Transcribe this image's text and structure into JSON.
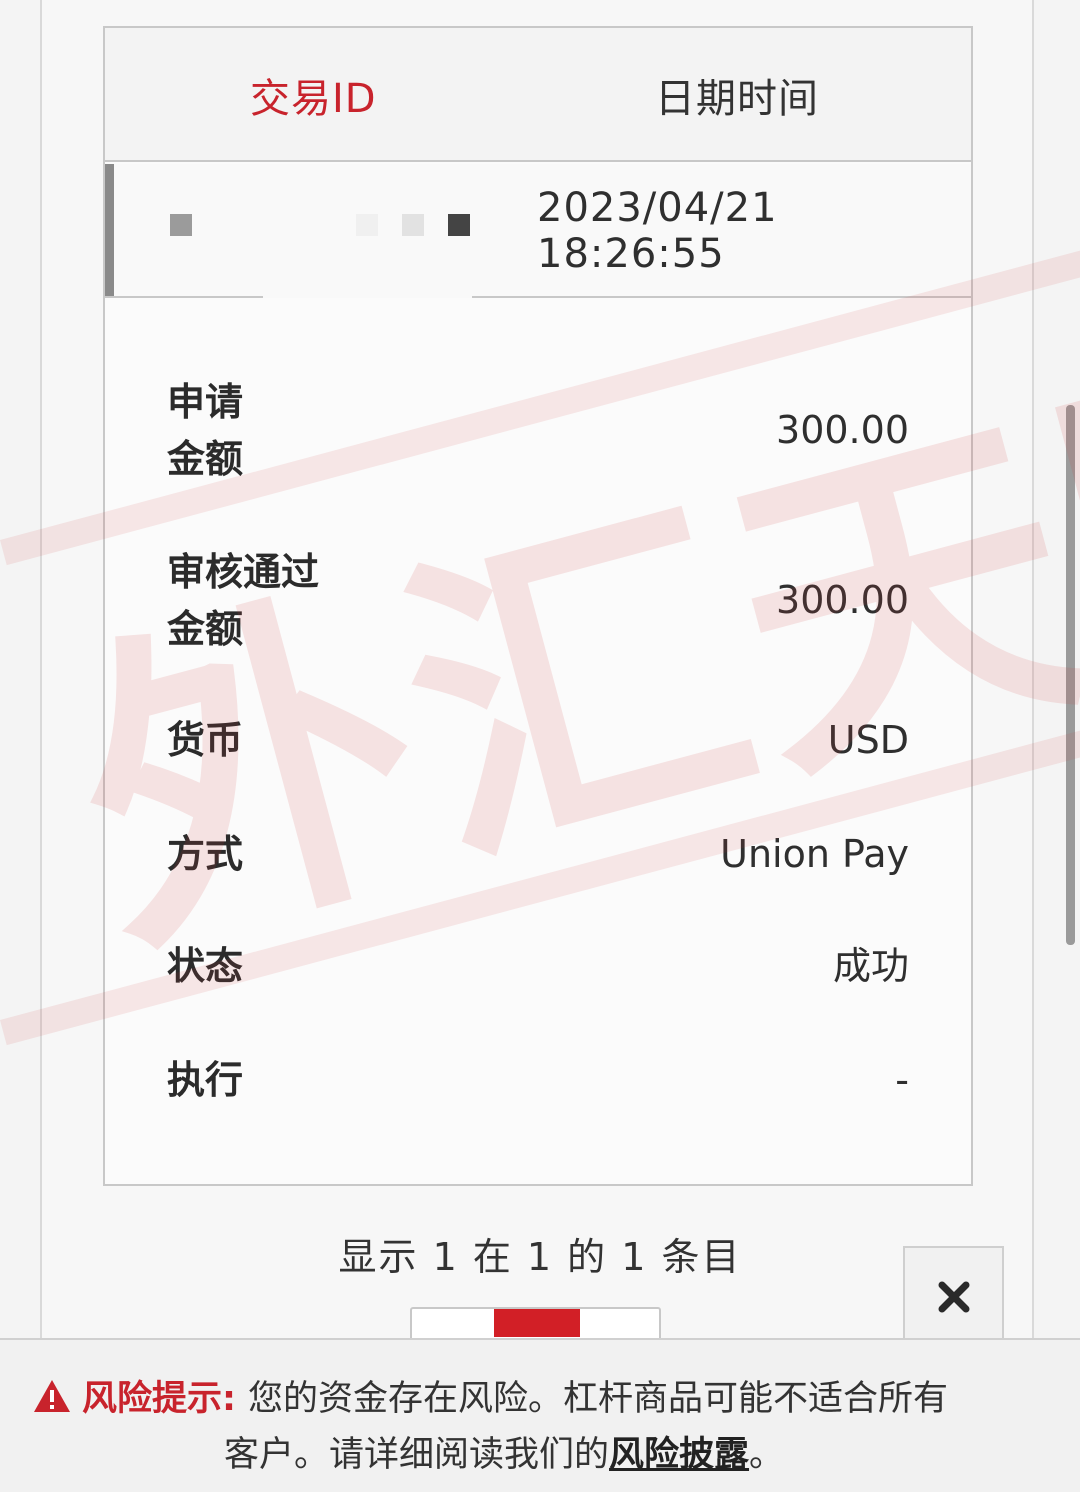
{
  "table": {
    "header": {
      "col_id": "交易ID",
      "col_date": "日期时间"
    },
    "record": {
      "transaction_id_masked": true,
      "datetime": "2023/04/21 18:26:55",
      "details": [
        {
          "label_line1": "申请",
          "label_line2": "金额",
          "value": "300.00"
        },
        {
          "label_line1": "审核通过",
          "label_line2": "金额",
          "value": "300.00"
        },
        {
          "label_line1": "货币",
          "label_line2": "",
          "value": "USD"
        },
        {
          "label_line1": "方式",
          "label_line2": "",
          "value": "Union Pay"
        },
        {
          "label_line1": "状态",
          "label_line2": "",
          "value": "成功"
        },
        {
          "label_line1": "执行",
          "label_line2": "",
          "value": "-"
        }
      ]
    }
  },
  "pagination": {
    "info": "显示 1 在 1 的 1 条目"
  },
  "risk_notice": {
    "title": "风险提示:",
    "text_line1": "您的资金存在风险。杠杆商品可能不适合所有",
    "text_line2_prefix": "客户。请详细阅读我们的",
    "link": "风险披露",
    "text_line2_suffix": "。"
  },
  "watermark": {
    "text": "外汇天眼"
  },
  "icons": {
    "close": "close-icon",
    "warning": "warning-icon"
  },
  "colors": {
    "accent": "#c8232c",
    "pager_active": "#d21f26"
  }
}
